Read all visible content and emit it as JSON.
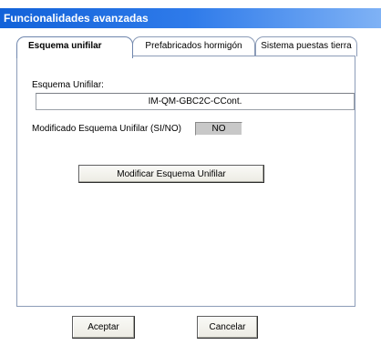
{
  "window": {
    "title": "Funcionalidades avanzadas"
  },
  "tabs": [
    {
      "label": "Esquema unifilar",
      "active": true
    },
    {
      "label": "Prefabricados hormigón",
      "active": false
    },
    {
      "label": "Sistema puestas tierra",
      "active": false
    }
  ],
  "panel": {
    "esquema_label": "Esquema Unifilar:",
    "esquema_value": "IM-QM-GBC2C-CCont.",
    "modificado_label": "Modificado Esquema Unifilar (SI/NO)",
    "modificado_value": "NO",
    "modificar_button": "Modificar Esquema Unifilar"
  },
  "footer": {
    "accept_button": "Aceptar",
    "cancel_button": "Cancelar"
  },
  "colors": {
    "title_bar_start": "#1262d9",
    "title_bar_end": "#7fb2f5",
    "readonly_bg": "#c8c8c8"
  }
}
